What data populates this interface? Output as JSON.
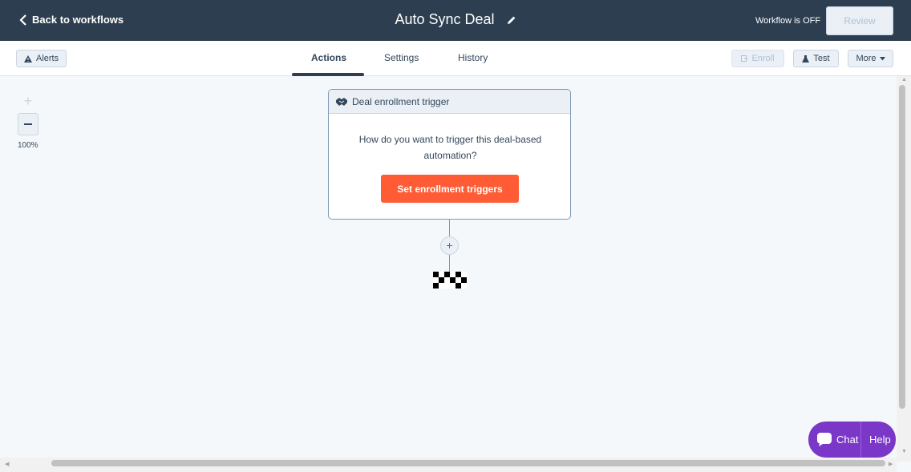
{
  "topbar": {
    "back_label": "Back to workflows",
    "title": "Auto Sync Deal",
    "status": "Workflow is OFF",
    "review_label": "Review"
  },
  "toolbar": {
    "alerts_label": "Alerts",
    "tabs": [
      {
        "label": "Actions",
        "active": true
      },
      {
        "label": "Settings",
        "active": false
      },
      {
        "label": "History",
        "active": false
      }
    ],
    "enroll_label": "Enroll",
    "test_label": "Test",
    "more_label": "More"
  },
  "zoom": {
    "in_symbol": "+",
    "level": "100%"
  },
  "trigger_card": {
    "header": "Deal enrollment trigger",
    "question": "How do you want to trigger this deal-based automation?",
    "button_label": "Set enrollment triggers"
  },
  "add_action_symbol": "+",
  "chat": {
    "chat_label": "Chat",
    "help_label": "Help"
  },
  "colors": {
    "topbar_bg": "#2d3e50",
    "primary_button": "#ff5c35",
    "chat_widget": "#7a37c8",
    "canvas_bg": "#f5f8fa"
  },
  "icons": {
    "back": "chevron-left-icon",
    "edit": "pencil-icon",
    "alerts": "warning-icon",
    "enroll": "enroll-icon",
    "test": "flask-icon",
    "more": "caret-down-icon",
    "trigger": "handshake-icon",
    "end": "checkered-flag-icon",
    "chat": "speech-bubble-icon"
  }
}
